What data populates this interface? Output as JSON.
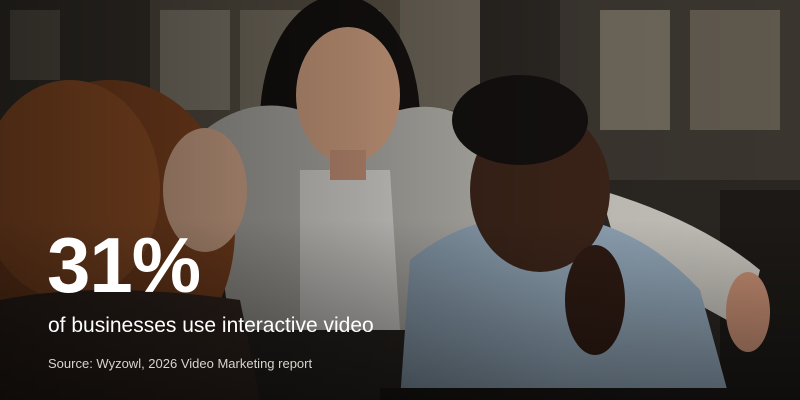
{
  "stat": {
    "value": "31%",
    "description": "of businesses use interactive video"
  },
  "source": {
    "text": "Source: Wyzowl, 2026 Video Marketing report"
  },
  "colors": {
    "text": "#ffffff",
    "source_text": "#d8d3cc",
    "background": "#1d1a17"
  }
}
